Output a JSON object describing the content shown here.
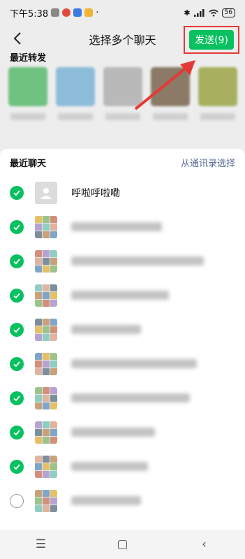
{
  "statusbar": {
    "time": "下午5:38",
    "battery": "56"
  },
  "header": {
    "title": "选择多个聊天",
    "send_label": "发送(9)"
  },
  "recent": {
    "title": "最近转发",
    "avatar_colors": [
      "#6fc27f",
      "#8cbcd8",
      "#b9b9b9",
      "#8a7a66",
      "#a8b060"
    ]
  },
  "contacts": {
    "section_title": "最近聊天",
    "address_book_link": "从通讯录选择",
    "rows": [
      {
        "name": "呼啦呼啦嘞",
        "checked": true
      },
      {
        "checked": true
      },
      {
        "checked": true
      },
      {
        "checked": true
      },
      {
        "checked": true
      },
      {
        "checked": true
      },
      {
        "checked": true
      },
      {
        "checked": true
      },
      {
        "checked": true
      },
      {
        "checked": false
      }
    ]
  },
  "colors": {
    "accent": "#07c160",
    "link": "#576b95",
    "highlight": "#e53935"
  }
}
